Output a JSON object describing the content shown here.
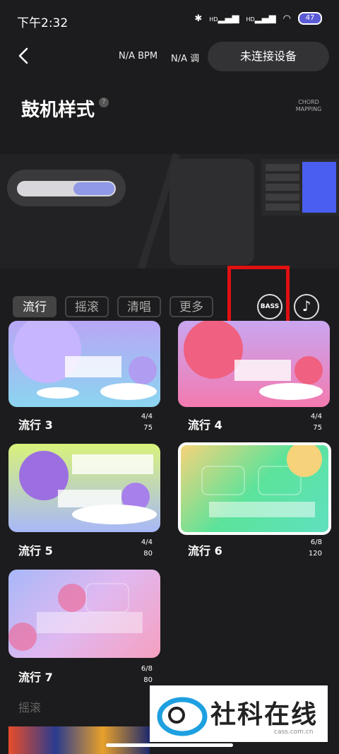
{
  "status": {
    "time": "下午2:32",
    "battery": "47",
    "signal1": "HD",
    "signal2": "HD"
  },
  "topbar": {
    "bpm": "N/A BPM",
    "key": "N/A 调",
    "connect_label": "未连接设备"
  },
  "header": {
    "title": "鼓机样式",
    "help": "?",
    "chord_mapping_1": "CHORD",
    "chord_mapping_2": "MAPPING"
  },
  "tabs": [
    {
      "label": "流行"
    },
    {
      "label": "摇滚"
    },
    {
      "label": "清唱"
    },
    {
      "label": "更多"
    }
  ],
  "buttons": {
    "bass": "BASS",
    "note": "♪"
  },
  "cards": [
    {
      "name": "流行 3",
      "meter": "4/4",
      "bpm": "75"
    },
    {
      "name": "流行 4",
      "meter": "4/4",
      "bpm": "75"
    },
    {
      "name": "流行 5",
      "meter": "4/4",
      "bpm": "80"
    },
    {
      "name": "流行 6",
      "meter": "6/8",
      "bpm": "120"
    },
    {
      "name": "流行 7",
      "meter": "6/8",
      "bpm": "80"
    }
  ],
  "section_next": "摇滚",
  "watermark": {
    "text": "社科在线",
    "sub": "cass.com.cn"
  }
}
